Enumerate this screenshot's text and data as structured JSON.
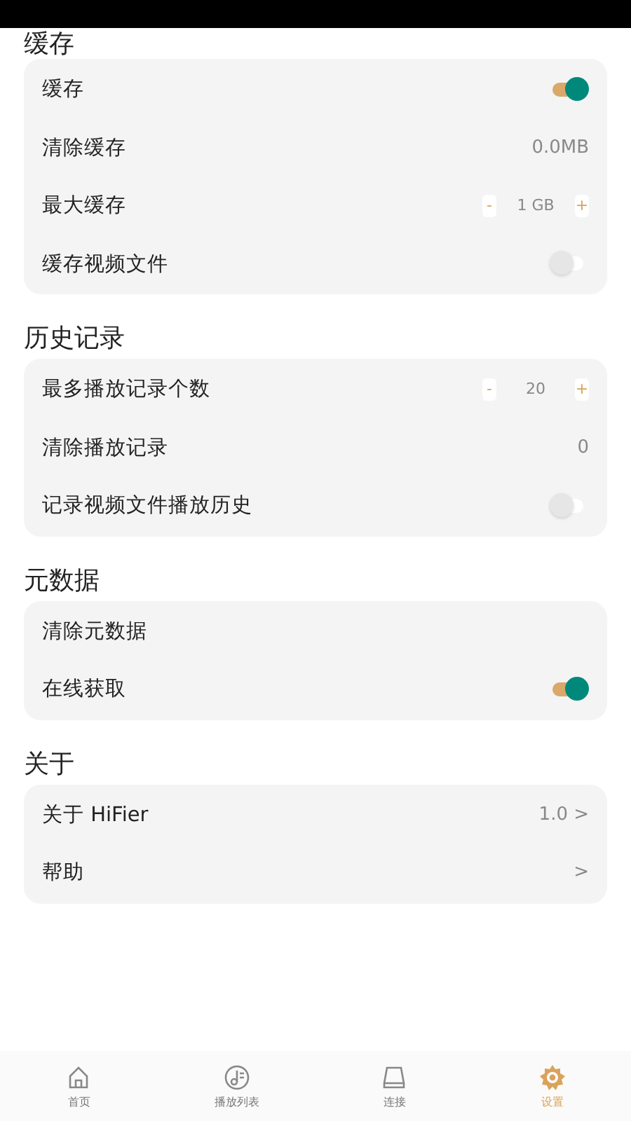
{
  "sections": [
    {
      "title": "缓存",
      "rows": [
        {
          "kind": "toggle",
          "label": "缓存",
          "on": true
        },
        {
          "kind": "value",
          "label": "清除缓存",
          "value": "0.0MB"
        },
        {
          "kind": "stepper",
          "label": "最大缓存",
          "minus": "-",
          "value": "1 GB",
          "plus": "+"
        },
        {
          "kind": "toggle",
          "label": "缓存视频文件",
          "on": false
        }
      ]
    },
    {
      "title": "历史记录",
      "rows": [
        {
          "kind": "stepper",
          "label": "最多播放记录个数",
          "minus": "-",
          "value": "20",
          "plus": "+"
        },
        {
          "kind": "value",
          "label": "清除播放记录",
          "value": "0"
        },
        {
          "kind": "toggle",
          "label": "记录视频文件播放历史",
          "on": false
        }
      ]
    },
    {
      "title": "元数据",
      "rows": [
        {
          "kind": "plain",
          "label": "清除元数据"
        },
        {
          "kind": "toggle",
          "label": "在线获取",
          "on": true
        }
      ]
    },
    {
      "title": "关于",
      "rows": [
        {
          "kind": "value",
          "label": "关于 HiFier",
          "value": "1.0 >"
        },
        {
          "kind": "value",
          "label": "帮助",
          "value": ">"
        }
      ]
    }
  ],
  "nav": [
    {
      "kind": "home",
      "label": "首页",
      "selected": false
    },
    {
      "kind": "playlist",
      "label": "播放列表",
      "selected": false
    },
    {
      "kind": "drive",
      "label": "连接",
      "selected": false
    },
    {
      "kind": "settings",
      "label": "设置",
      "selected": true
    }
  ]
}
